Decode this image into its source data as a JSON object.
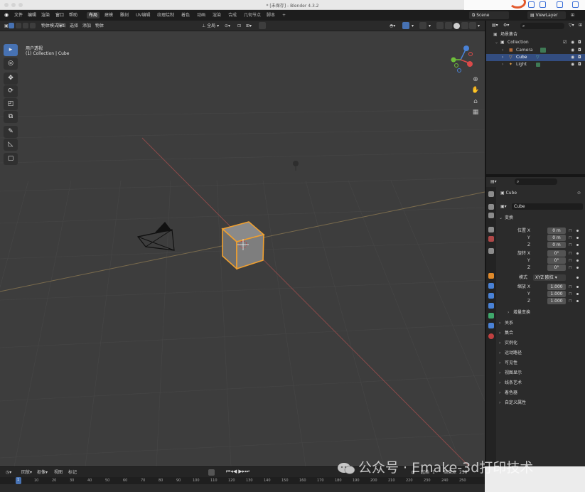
{
  "window": {
    "title": "* [未保存] - Blender 4.3.2"
  },
  "topbar": {
    "menus": [
      "文件",
      "编辑",
      "渲染",
      "窗口",
      "帮助"
    ],
    "workspaces": [
      "布局",
      "建模",
      "雕刻",
      "UV编辑",
      "纹理绘制",
      "着色",
      "动画",
      "渲染",
      "合成",
      "几何节点",
      "脚本"
    ],
    "add_tab": "+",
    "scene": "Scene",
    "view_layer": "ViewLayer"
  },
  "viewport_header": {
    "mode": "物体模式",
    "menus": [
      "视图",
      "选择",
      "添加",
      "物体"
    ],
    "transform_orientation": "全局"
  },
  "viewport": {
    "view_name": "用户透视",
    "collection_info": "(1) Collection | Cube",
    "gizmo_axes": [
      "X",
      "Y",
      "Z"
    ]
  },
  "outliner": {
    "search_placeholder": "",
    "scene_collection": "场景集合",
    "collection": "Collection",
    "items": [
      {
        "name": "Camera",
        "icon": "camera-icon",
        "color": "#b56a3a"
      },
      {
        "name": "Cube",
        "icon": "mesh-icon",
        "color": "#e3a34b"
      },
      {
        "name": "Light",
        "icon": "light-icon",
        "color": "#e3a34b"
      }
    ]
  },
  "properties": {
    "object_name": "Cube",
    "datablock": "Cube",
    "transform_section": "变换",
    "location_label": "位置 X",
    "rotation_label": "旋转 X",
    "scale_label": "缩放 X",
    "mode_label": "模式",
    "mode_value": "XYZ 欧拉",
    "axes": [
      "Y",
      "Z"
    ],
    "location": [
      "0 m",
      "0 m",
      "0 m"
    ],
    "rotation": [
      "0°",
      "0°",
      "0°"
    ],
    "scale": [
      "1.000",
      "1.000",
      "1.000"
    ],
    "delta_transform": "增量变换",
    "sections": [
      "关系",
      "集合",
      "实例化",
      "运动路径",
      "可见性",
      "视图显示",
      "线条艺术",
      "着色器",
      "自定义属性"
    ],
    "accent": "#4772b3"
  },
  "timeline": {
    "menus": [
      "回放",
      "抠像",
      "视图",
      "标记"
    ],
    "frame_ticks": [
      "1",
      "10",
      "20",
      "30",
      "40",
      "50",
      "60",
      "70",
      "80",
      "90",
      "100",
      "110",
      "120",
      "130",
      "140",
      "150",
      "160",
      "170",
      "180",
      "190",
      "200",
      "210",
      "220",
      "230",
      "240",
      "250"
    ],
    "current_frame": "1",
    "start_label": "起始",
    "start": "1",
    "end_label": "结束点",
    "end": "250"
  },
  "watermark": {
    "text": "公众号 · Emake-3d打印技术"
  }
}
